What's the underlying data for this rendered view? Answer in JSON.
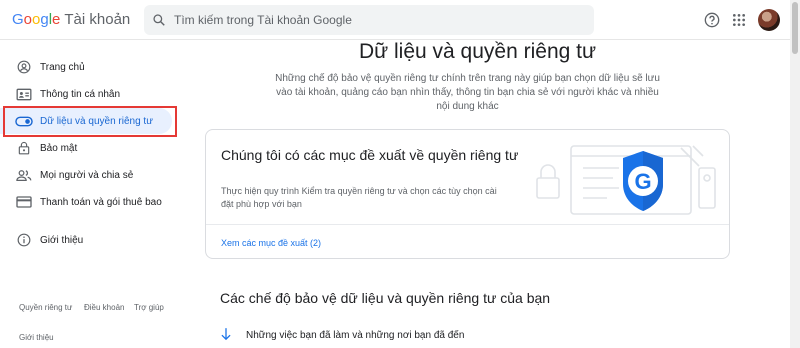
{
  "header": {
    "logo_letters": [
      "G",
      "o",
      "o",
      "g",
      "l",
      "e"
    ],
    "product": "Tài khoản",
    "search_placeholder": "Tìm kiếm trong Tài khoản Google",
    "icons": [
      "search-icon",
      "help-icon",
      "apps-icon"
    ]
  },
  "sidebar": {
    "items": [
      {
        "label": "Trang chủ",
        "icon": "home-icon"
      },
      {
        "label": "Thông tin cá nhân",
        "icon": "id-card-icon"
      },
      {
        "label": "Dữ liệu và quyền riêng tư",
        "icon": "toggle-icon",
        "active": true
      },
      {
        "label": "Bảo mật",
        "icon": "lock-icon"
      },
      {
        "label": "Mọi người và chia sẻ",
        "icon": "people-icon"
      },
      {
        "label": "Thanh toán và gói thuê bao",
        "icon": "card-icon"
      },
      {
        "label": "Giới thiệu",
        "icon": "info-icon"
      }
    ],
    "footer": {
      "privacy": "Quyền riêng tư",
      "terms": "Điều khoản",
      "help": "Trợ giúp",
      "about": "Giới thiệu"
    }
  },
  "main": {
    "title": "Dữ liệu và quyền riêng tư",
    "description": "Những chế độ bảo vệ quyền riêng tư chính trên trang này giúp bạn chọn dữ liệu sẽ lưu vào tài khoản, quảng cáo bạn nhìn thấy, thông tin bạn chia sẻ với người khác và nhiều nội dung khác",
    "card": {
      "title": "Chúng tôi có các mục đề xuất về quyền riêng tư",
      "description": "Thực hiện quy trình Kiểm tra quyền riêng tư và chọn các tùy chọn cài đặt phù hợp với bạn",
      "link": "Xem các mục đề xuất (2)"
    },
    "section_title": "Các chế độ bảo vệ dữ liệu và quyền riêng tư của bạn",
    "section_item": "Những việc bạn đã làm và những nơi bạn đã đến"
  },
  "colors": {
    "accent": "#1a73e8",
    "active_bg": "#e8f0fe",
    "highlight_border": "#e53935"
  }
}
